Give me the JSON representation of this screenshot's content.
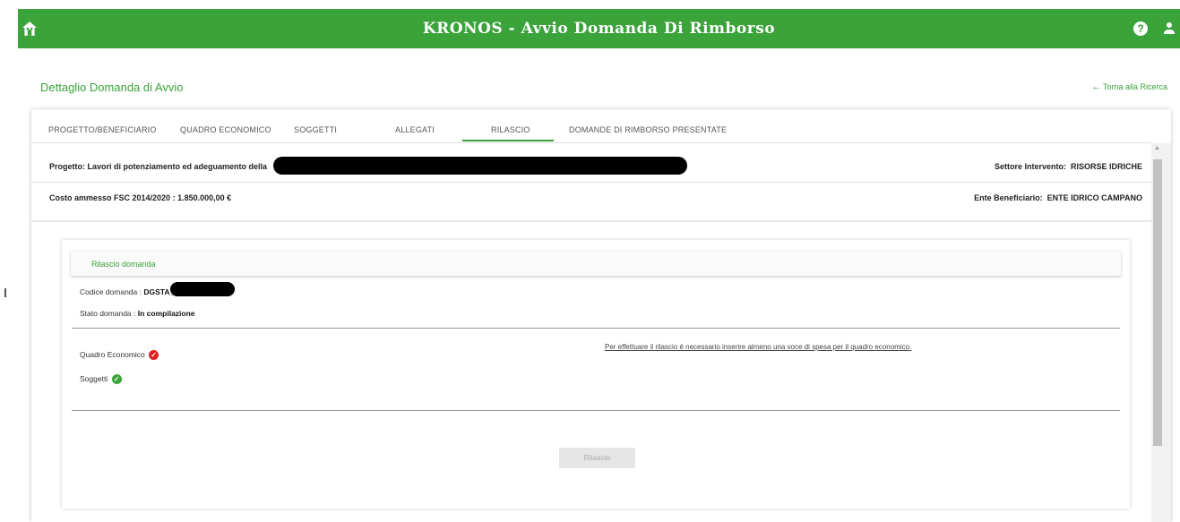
{
  "header": {
    "title": "KRONOS - Avvio Domanda Di Rimborso",
    "home_icon": "home-icon",
    "help_icon": "help-icon",
    "help_glyph": "?",
    "user_icon": "user-icon",
    "brand_color": "#3aa33a"
  },
  "page": {
    "title": "Dettaglio Domanda di Avvio",
    "back_link": "Torna alla Ricerca",
    "back_arrow": "←"
  },
  "tabs": [
    {
      "label": "PROGETTO/BENEFICIARIO",
      "active": false
    },
    {
      "label": "QUADRO ECONOMICO",
      "active": false
    },
    {
      "label": "SOGGETTI",
      "active": false
    },
    {
      "label": "ALLEGATI",
      "active": false
    },
    {
      "label": "RILASCIO",
      "active": true
    },
    {
      "label": "DOMANDE DI RIMBORSO PRESENTATE",
      "active": false
    }
  ],
  "project": {
    "progetto_label": "Progetto:",
    "progetto_value": "Lavori di potenziamento ed adeguamento della",
    "settore_label": "Settore Intervento:",
    "settore_value": "RISORSE IDRICHE",
    "costo_text": "Costo ammesso FSC 2014/2020 : 1.850.000,00 €",
    "ente_label": "Ente Beneficiario:",
    "ente_value": "ENTE IDRICO CAMPANO"
  },
  "rilascio": {
    "section_title": "Rilascio domanda",
    "codice_label": "Codice domanda :",
    "codice_value": "DGSTA_",
    "stato_label": "Stato domanda :",
    "stato_value": "In compilazione",
    "warning": "Per effettuare il rilascio è necessario inserire almeno una voce di spesa per il quadro economico.",
    "checks": [
      {
        "label": "Quadro Economico",
        "status": "error",
        "icon": "error-check-icon",
        "glyph": "✓"
      },
      {
        "label": "Soggetti",
        "status": "ok",
        "icon": "ok-check-icon",
        "glyph": "✓"
      }
    ],
    "button_label": "Rilascio",
    "button_enabled": false
  }
}
